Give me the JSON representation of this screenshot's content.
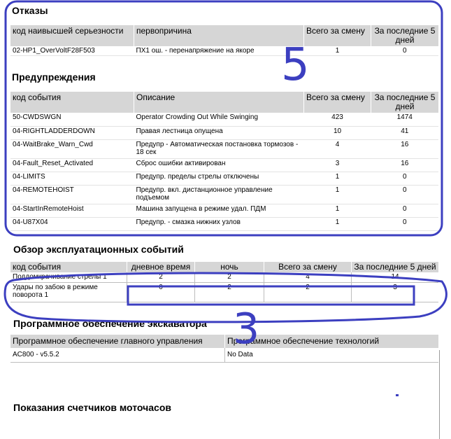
{
  "failures": {
    "title": "Отказы",
    "headers": [
      "код наивысшей серьезности",
      "первопричина",
      "Всего за смену",
      "За последние 5 дней"
    ],
    "rows": [
      [
        "02-HP1_OverVoltF28F503",
        "ПХ1 ош. - перенапряжение на якоре",
        "1",
        "0"
      ]
    ]
  },
  "warnings": {
    "title": "Предупреждения",
    "headers": [
      "код события",
      "Описание",
      "Всего за смену",
      "За последние 5 дней"
    ],
    "rows": [
      [
        "50-CWDSWGN",
        "Operator Crowding Out While Swinging",
        "423",
        "1474"
      ],
      [
        "04-RIGHTLADDERDOWN",
        "Правая лестница опущена",
        "10",
        "41"
      ],
      [
        "04-WaitBrake_Warn_Cwd",
        "Предупр - Автоматическая постановка тормозов - 18 сек",
        "4",
        "16"
      ],
      [
        "04-Fault_Reset_Activated",
        "Сброс ошибки активирован",
        "3",
        "16"
      ],
      [
        "04-LIMITS",
        "Предупр. пределы стрелы отключены",
        "1",
        "0"
      ],
      [
        "04-REMOTEHOIST",
        "Предупр. вкл. дистанционное управление подъемом",
        "1",
        "0"
      ],
      [
        "04-StartInRemoteHoist",
        "Машина запущена в режиме удал. ПДМ",
        "1",
        "0"
      ],
      [
        "04-U87X04",
        "Предупр. - смазка нижних узлов",
        "1",
        "0"
      ]
    ]
  },
  "events": {
    "title": "Обзор эксплуатационных событий",
    "headers": [
      "код события",
      "дневное время",
      "ночь",
      "Всего за смену",
      "За последние 5 дней"
    ],
    "rows": [
      [
        "Поддомкрачивание стрелы 1",
        "2",
        "2",
        "4",
        "14"
      ],
      [
        "Удары по забою в режиме поворота 1",
        "0",
        "2",
        "2",
        "3"
      ]
    ]
  },
  "software": {
    "title": "Программное обеспечение экскаватора",
    "headers": [
      "Программное обеспечение главного управления",
      "Программное обеспечение технологий"
    ],
    "rows": [
      [
        "AC800 - v5.5.2",
        "No Data"
      ]
    ]
  },
  "hours": {
    "title": "Показания счетчиков моточасов"
  },
  "annotations": {
    "top_number": "5",
    "middle_number": "3",
    "color": "#3c3fc0"
  }
}
